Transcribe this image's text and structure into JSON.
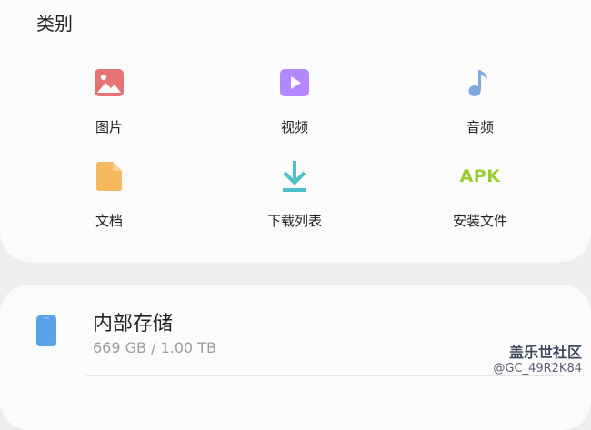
{
  "categories": {
    "title": "类别",
    "items": [
      {
        "label": "图片",
        "icon": "image-icon",
        "color": "#e57373"
      },
      {
        "label": "视频",
        "icon": "video-icon",
        "color": "#b388ff"
      },
      {
        "label": "音频",
        "icon": "music-note-icon",
        "color": "#7fa8e0"
      },
      {
        "label": "文档",
        "icon": "document-icon",
        "color": "#f5b95f"
      },
      {
        "label": "下载列表",
        "icon": "download-icon",
        "color": "#4dc0c7"
      },
      {
        "label": "安装文件",
        "icon": "apk-icon",
        "icon_text": "APK",
        "color": "#9acd32"
      }
    ]
  },
  "storage": {
    "title": "内部存储",
    "usage": "669 GB / 1.00 TB",
    "icon": "phone-icon",
    "color": "#5aa2e6"
  },
  "watermark": {
    "title": "盖乐世社区",
    "sub": "@GC_49R2K84"
  }
}
